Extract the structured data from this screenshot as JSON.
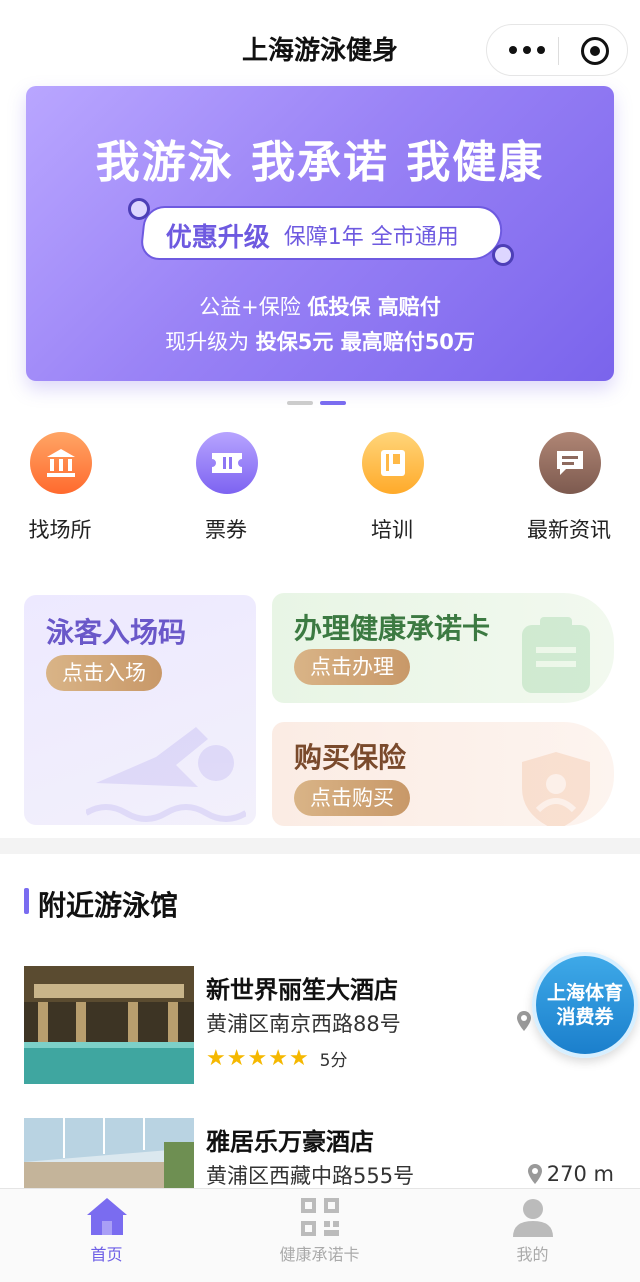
{
  "header": {
    "title": "上海游泳健身"
  },
  "banner": {
    "headline": "我游泳 我承诺 我健康",
    "badge_main": "优惠升级",
    "badge_sub": "保障1年 全市通用",
    "line1_prefix": "公益+保险",
    "line1_bold": "低投保 高赔付",
    "line2_prefix": "现升级为",
    "line2_bold": "投保5元 最高赔付50万",
    "page_count": 2,
    "active_index": 1
  },
  "quick_nav": [
    {
      "label": "找场所",
      "icon": "building-icon"
    },
    {
      "label": "票券",
      "icon": "ticket-icon"
    },
    {
      "label": "培训",
      "icon": "book-icon"
    },
    {
      "label": "最新资讯",
      "icon": "message-icon"
    }
  ],
  "service_cards": {
    "entry": {
      "title": "泳客入场码",
      "button": "点击入场"
    },
    "health_card": {
      "title": "办理健康承诺卡",
      "button": "点击办理"
    },
    "insurance": {
      "title": "购买保险",
      "button": "点击购买"
    }
  },
  "nearby": {
    "title": "附近游泳馆",
    "venues": [
      {
        "name": "新世界丽笙大酒店",
        "address": "黄浦区南京西路88号",
        "rating_stars": 5,
        "score": "5分",
        "distance": ""
      },
      {
        "name": "雅居乐万豪酒店",
        "address": "黄浦区西藏中路555号",
        "rating_stars": 0,
        "score": "",
        "distance": "270 m"
      }
    ]
  },
  "float_coupon": {
    "line1": "上海体育",
    "line2": "消费券"
  },
  "tabbar": [
    {
      "label": "首页",
      "active": true
    },
    {
      "label": "健康承诺卡",
      "active": false
    },
    {
      "label": "我的",
      "active": false
    }
  ],
  "colors": {
    "accent": "#7a6cf0",
    "tab_active": "#6d5ee6",
    "star": "#f5b800",
    "coupon": "#2a95dc"
  }
}
